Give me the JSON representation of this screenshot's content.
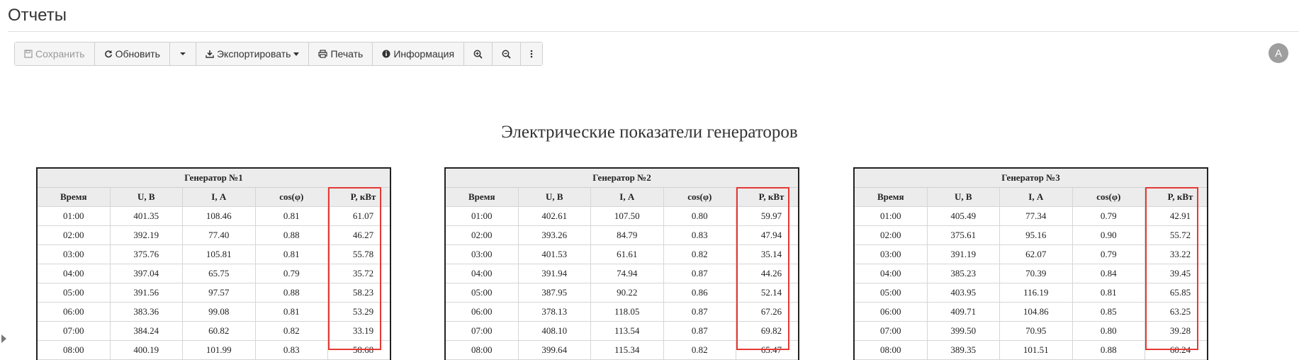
{
  "page": {
    "title": "Отчеты"
  },
  "toolbar": {
    "save_label": "Сохранить",
    "refresh_label": "Обновить",
    "export_label": "Экспортировать",
    "print_label": "Печать",
    "info_label": "Информация"
  },
  "user": {
    "avatar_letter": "A"
  },
  "report": {
    "title": "Электрические показатели генераторов",
    "columns": [
      "Время",
      "U, В",
      "I, А",
      "cos(φ)",
      "P, кВт"
    ],
    "generators": [
      {
        "name": "Генератор №1",
        "rows": [
          [
            "01:00",
            "401.35",
            "108.46",
            "0.81",
            "61.07"
          ],
          [
            "02:00",
            "392.19",
            "77.40",
            "0.88",
            "46.27"
          ],
          [
            "03:00",
            "375.76",
            "105.81",
            "0.81",
            "55.78"
          ],
          [
            "04:00",
            "397.04",
            "65.75",
            "0.79",
            "35.72"
          ],
          [
            "05:00",
            "391.56",
            "97.57",
            "0.88",
            "58.23"
          ],
          [
            "06:00",
            "383.36",
            "99.08",
            "0.81",
            "53.29"
          ],
          [
            "07:00",
            "384.24",
            "60.82",
            "0.82",
            "33.19"
          ],
          [
            "08:00",
            "400.19",
            "101.99",
            "0.83",
            "58.68"
          ]
        ]
      },
      {
        "name": "Генератор №2",
        "rows": [
          [
            "01:00",
            "402.61",
            "107.50",
            "0.80",
            "59.97"
          ],
          [
            "02:00",
            "393.26",
            "84.79",
            "0.83",
            "47.94"
          ],
          [
            "03:00",
            "401.53",
            "61.61",
            "0.82",
            "35.14"
          ],
          [
            "04:00",
            "391.94",
            "74.94",
            "0.87",
            "44.26"
          ],
          [
            "05:00",
            "387.95",
            "90.22",
            "0.86",
            "52.14"
          ],
          [
            "06:00",
            "378.13",
            "118.05",
            "0.87",
            "67.26"
          ],
          [
            "07:00",
            "408.10",
            "113.54",
            "0.87",
            "69.82"
          ],
          [
            "08:00",
            "399.64",
            "115.34",
            "0.82",
            "65.47"
          ]
        ]
      },
      {
        "name": "Генератор №3",
        "rows": [
          [
            "01:00",
            "405.49",
            "77.34",
            "0.79",
            "42.91"
          ],
          [
            "02:00",
            "375.61",
            "95.16",
            "0.90",
            "55.72"
          ],
          [
            "03:00",
            "391.19",
            "62.07",
            "0.79",
            "33.22"
          ],
          [
            "04:00",
            "385.23",
            "70.39",
            "0.84",
            "39.45"
          ],
          [
            "05:00",
            "403.95",
            "116.19",
            "0.81",
            "65.85"
          ],
          [
            "06:00",
            "409.71",
            "104.86",
            "0.85",
            "63.25"
          ],
          [
            "07:00",
            "399.50",
            "70.95",
            "0.80",
            "39.28"
          ],
          [
            "08:00",
            "389.35",
            "101.51",
            "0.88",
            "60.24"
          ]
        ]
      }
    ]
  },
  "colors": {
    "highlight": "#e53935",
    "header_bg": "#ececec"
  }
}
